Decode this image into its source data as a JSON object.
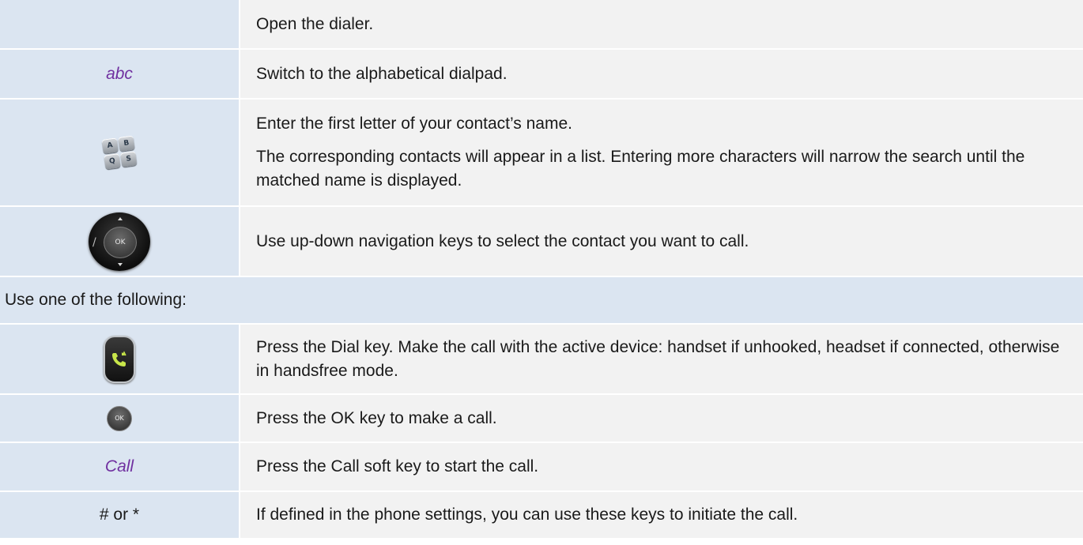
{
  "rows": [
    {
      "key": "",
      "text": [
        "Open the dialer."
      ]
    },
    {
      "key": "abc",
      "text": [
        "Switch to the alphabetical dialpad."
      ]
    },
    {
      "key_icon": "alphabetical-keypad-icon",
      "text": [
        "Enter the first letter of your contact’s name.",
        "The corresponding contacts will appear in a list. Entering more characters will narrow the search until the matched name is displayed."
      ]
    },
    {
      "key_icon": "navigation-ok-keys-icon",
      "key_icon_label": "OK",
      "key_icon_separator": "/",
      "text": [
        "Use up-down navigation keys to select the contact you want to call."
      ]
    }
  ],
  "section_header": "Use one of the following:",
  "options": [
    {
      "key_icon": "dial-key-icon",
      "text": "Press the Dial key. Make the call with the active device: handset if unhooked, headset if connected, otherwise in handsfree mode."
    },
    {
      "key_icon": "ok-key-icon",
      "key_icon_label": "OK",
      "text": "Press the OK key to make a call."
    },
    {
      "key": "Call",
      "text": "Press the Call soft key to start the call."
    },
    {
      "key": "# or *",
      "text": "If defined in the phone settings, you can use these keys to initiate the call."
    }
  ],
  "colors": {
    "left_cell_bg": "#dbe5f1",
    "right_cell_bg": "#f2f2f2",
    "softkey_text": "#7030a0",
    "dial_key_accent": "#c8e64a"
  }
}
